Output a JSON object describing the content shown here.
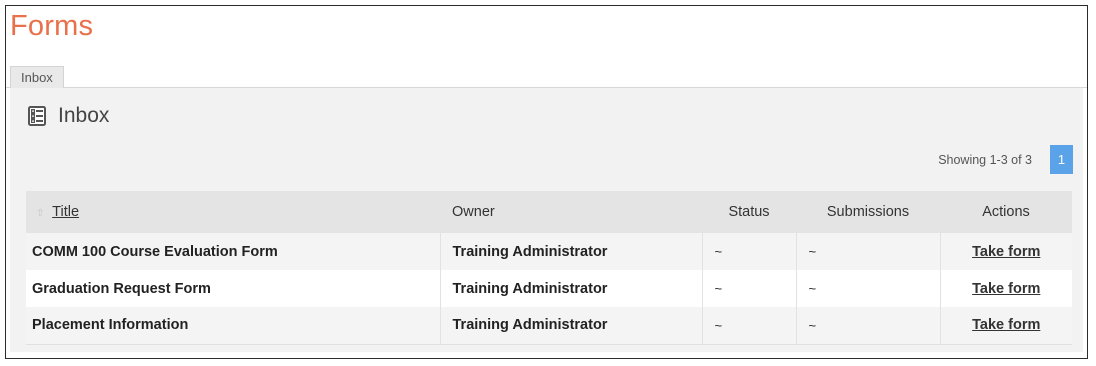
{
  "page": {
    "title": "Forms"
  },
  "tabs": [
    {
      "label": "Inbox",
      "selected": true
    }
  ],
  "panel": {
    "title": "Inbox",
    "icon": "form-list-icon"
  },
  "pagination": {
    "showing_text": "Showing 1-3 of 3",
    "current_page": "1"
  },
  "table": {
    "headers": {
      "title": "Title",
      "owner": "Owner",
      "status": "Status",
      "submissions": "Submissions",
      "actions": "Actions"
    },
    "sort_icon": "sort-arrow-icon",
    "rows": [
      {
        "title": "COMM 100 Course Evaluation Form",
        "owner": "Training Administrator",
        "status": "~",
        "submissions": "~",
        "action": "Take form"
      },
      {
        "title": "Graduation Request Form",
        "owner": "Training Administrator",
        "status": "~",
        "submissions": "~",
        "action": "Take form"
      },
      {
        "title": "Placement Information",
        "owner": "Training Administrator",
        "status": "~",
        "submissions": "~",
        "action": "Take form"
      }
    ]
  },
  "colors": {
    "title": "#e8704a",
    "page_button": "#5aa3e8",
    "panel_bg": "#f2f2f2"
  }
}
